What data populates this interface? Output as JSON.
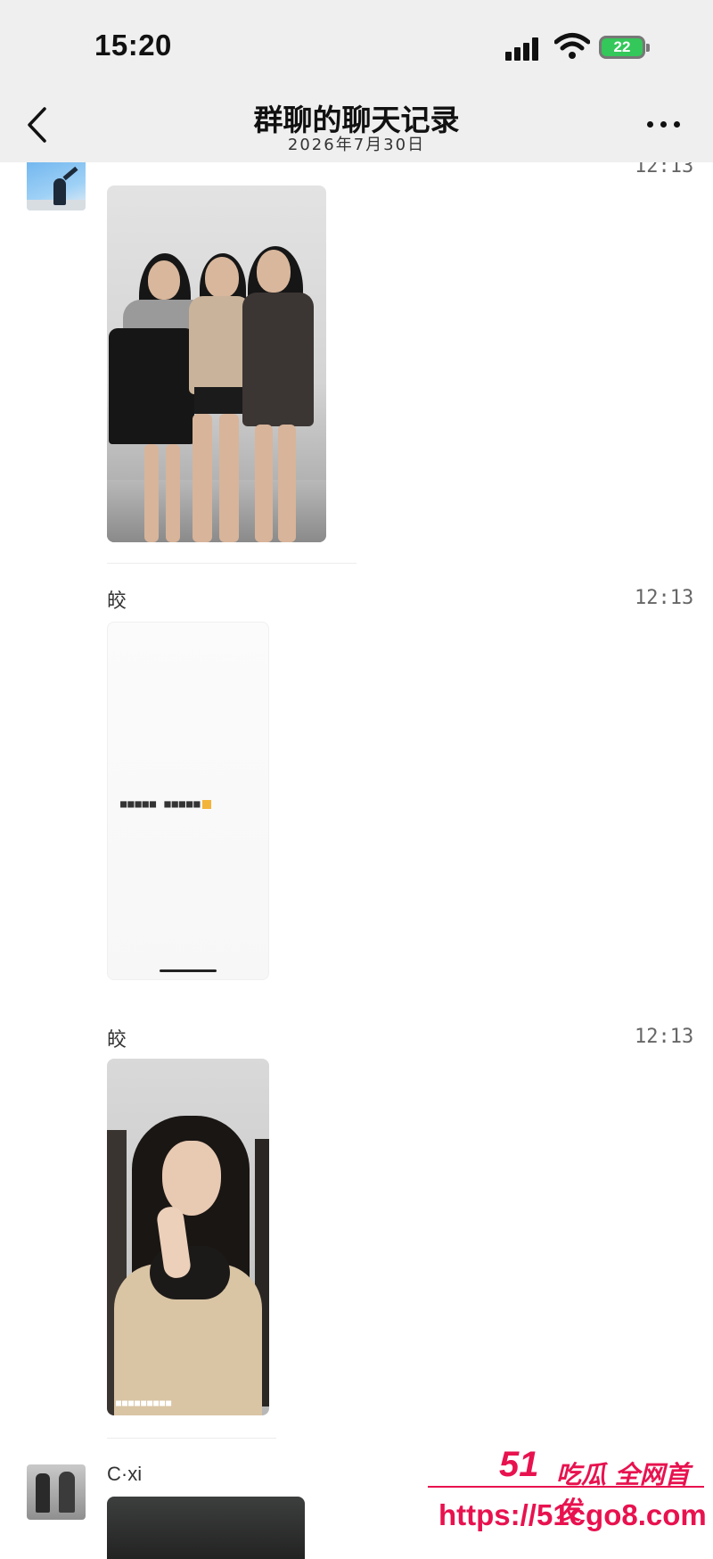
{
  "status_bar": {
    "time": "15:20",
    "battery": "22",
    "icons": [
      "signal-icon",
      "wifi-icon",
      "battery-icon"
    ]
  },
  "nav": {
    "title": "群聊的聊天记录",
    "subtitle": "2026年7月30日",
    "back_icon": "chevron-left-icon",
    "more_icon": "ellipsis-icon"
  },
  "messages": [
    {
      "sender": "",
      "time": "12:13",
      "content": "photo-three-girls"
    },
    {
      "sender": "皎",
      "time": "12:13",
      "content": "photo-phone-screen",
      "caption": "■■■■■ ■■■■■"
    },
    {
      "sender": "皎",
      "time": "12:13",
      "content": "photo-selfie",
      "caption": "■■■■■■■■■"
    },
    {
      "sender": "C·xi",
      "time": "",
      "content": "photo-dark"
    }
  ],
  "watermark": {
    "logo": "51",
    "slogan": "吃瓜 全网首发",
    "url": "https://51cgo8.com"
  },
  "colors": {
    "topbar_bg": "#efefef",
    "watermark": "#e8124f",
    "battery": "#34c759"
  }
}
